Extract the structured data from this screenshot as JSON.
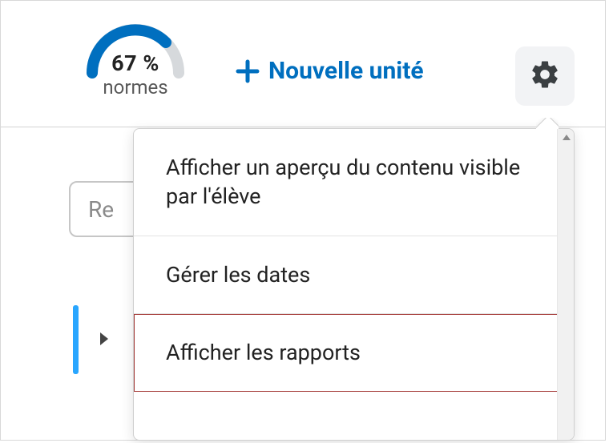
{
  "gauge": {
    "percent_text": "67 %",
    "label": "normes",
    "progress": 67
  },
  "toolbar": {
    "new_unit_label": "Nouvelle unité"
  },
  "search": {
    "placeholder": "Rechercher"
  },
  "menu": {
    "items": [
      {
        "label": "Afficher un aperçu du contenu visible par l'élève",
        "highlighted": false
      },
      {
        "label": "Gérer les dates",
        "highlighted": false
      },
      {
        "label": "Afficher les rapports",
        "highlighted": true
      }
    ]
  },
  "colors": {
    "accent": "#006fbf",
    "gauge_track": "#d6d9dc",
    "gauge_fill": "#006fbf",
    "highlight_border": "#a33835"
  }
}
